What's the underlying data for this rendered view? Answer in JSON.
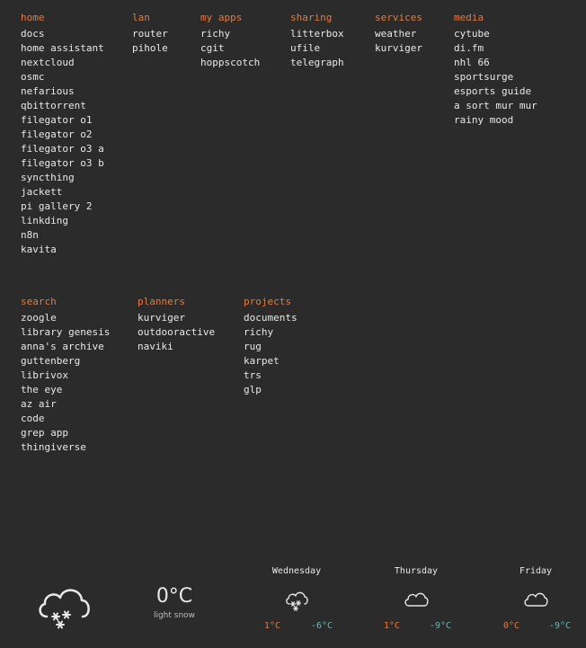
{
  "groups": [
    {
      "title": "home",
      "links": [
        "docs",
        "home assistant",
        "nextcloud",
        "osmc",
        "nefarious",
        "qbittorrent",
        "filegator o1",
        "filegator o2",
        "filegator o3 a",
        "filegator o3 b",
        "syncthing",
        "jackett",
        "pi gallery 2",
        "linkding",
        "n8n",
        "kavita"
      ]
    },
    {
      "title": "lan",
      "links": [
        "router",
        "pihole"
      ]
    },
    {
      "title": "my apps",
      "links": [
        "richy",
        "cgit",
        "hoppscotch"
      ]
    },
    {
      "title": "sharing",
      "links": [
        "litterbox",
        "ufile",
        "telegraph"
      ]
    },
    {
      "title": "services",
      "links": [
        "weather",
        "kurviger"
      ]
    },
    {
      "title": "media",
      "links": [
        "cytube",
        "di.fm",
        "nhl 66",
        "sportsurge",
        "esports guide",
        "a sort mur mur",
        "rainy mood"
      ]
    },
    {
      "title": "search",
      "links": [
        "zoogle",
        "library genesis",
        "anna's archive",
        "guttenberg",
        "librivox",
        "the eye",
        "az air",
        "code",
        "grep app",
        "thingiverse"
      ]
    },
    {
      "title": "planners",
      "links": [
        "kurviger",
        "outdooractive",
        "naviki"
      ]
    },
    {
      "title": "projects",
      "links": [
        "documents",
        "richy",
        "rug",
        "karpet",
        "trs",
        "glp"
      ]
    }
  ],
  "weather": {
    "current": {
      "temp": "0°C",
      "description": "light snow",
      "icon": "cloud-snow-icon"
    },
    "forecast": [
      {
        "day": "Wednesday",
        "high": "1°C",
        "low": "-6°C",
        "icon": "cloud-snow-icon"
      },
      {
        "day": "Thursday",
        "high": "1°C",
        "low": "-9°C",
        "icon": "cloud-icon"
      },
      {
        "day": "Friday",
        "high": "0°C",
        "low": "-9°C",
        "icon": "cloud-icon"
      }
    ]
  },
  "colors": {
    "background": "#2b2b2b",
    "accent": "#e8793a",
    "text": "#e8e8e8",
    "cold": "#6fb3b3"
  }
}
